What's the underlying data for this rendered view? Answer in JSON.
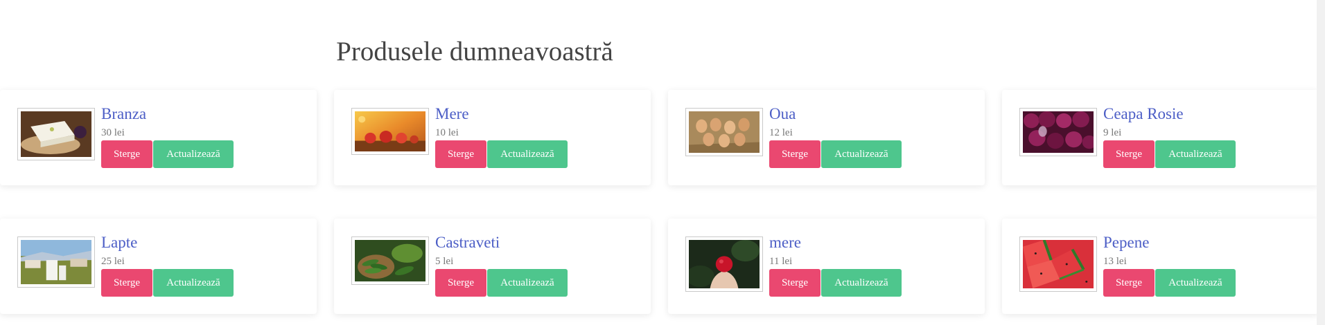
{
  "page": {
    "title": "Produsele dumneavoastră"
  },
  "products": [
    {
      "name": "Branza",
      "price": "30 lei",
      "delete_label": "Sterge",
      "update_label": "Actualizează",
      "image": "cheese-image"
    },
    {
      "name": "Mere",
      "price": "10 lei",
      "delete_label": "Sterge",
      "update_label": "Actualizează",
      "image": "apples-image"
    },
    {
      "name": "Oua",
      "price": "12 lei",
      "delete_label": "Sterge",
      "update_label": "Actualizează",
      "image": "eggs-image"
    },
    {
      "name": "Ceapa Rosie",
      "price": "9 lei",
      "delete_label": "Sterge",
      "update_label": "Actualizează",
      "image": "red-onion-image"
    },
    {
      "name": "Lapte",
      "price": "25 lei",
      "delete_label": "Sterge",
      "update_label": "Actualizează",
      "image": "milk-image"
    },
    {
      "name": "Castraveti",
      "price": "5 lei",
      "delete_label": "Sterge",
      "update_label": "Actualizează",
      "image": "cucumbers-image"
    },
    {
      "name": "mere",
      "price": "11 lei",
      "delete_label": "Sterge",
      "update_label": "Actualizează",
      "image": "apple-in-hand-image"
    },
    {
      "name": "Pepene",
      "price": "13 lei",
      "delete_label": "Sterge",
      "update_label": "Actualizează",
      "image": "watermelon-image"
    }
  ],
  "colors": {
    "name_link": "#4c5ec6",
    "delete_button": "#ea4870",
    "update_button": "#4ec68d",
    "title": "#444444"
  }
}
